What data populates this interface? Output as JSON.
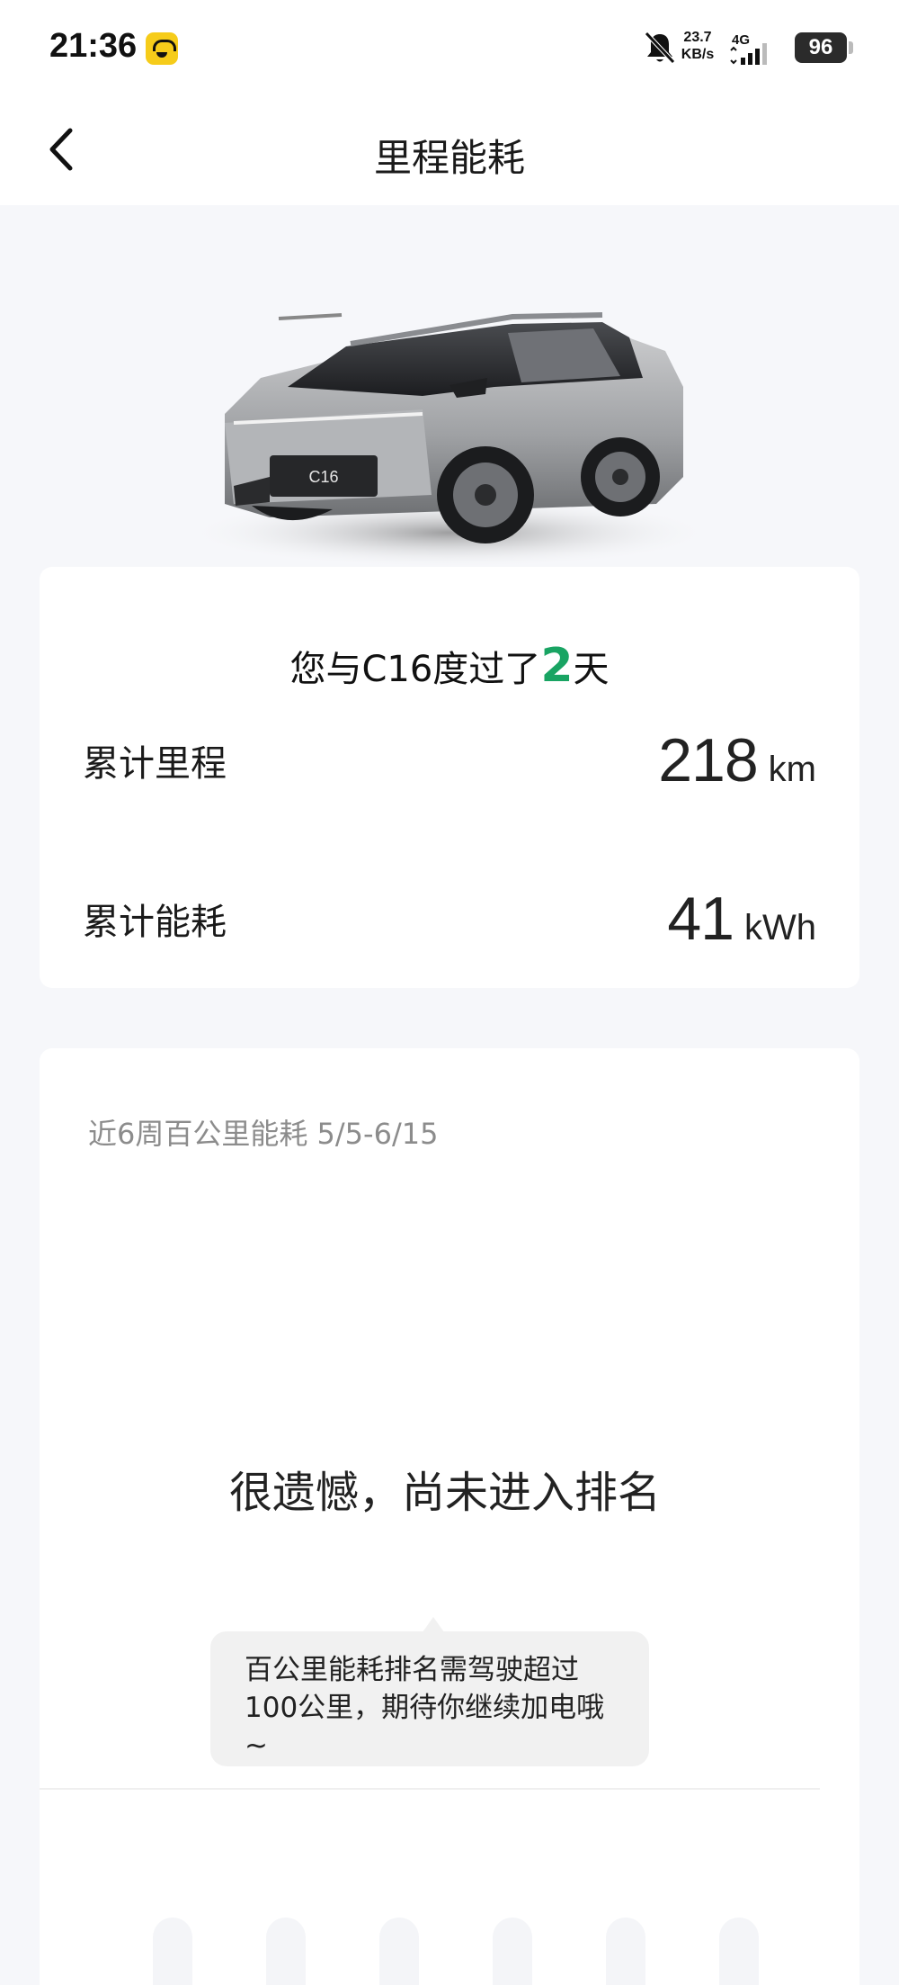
{
  "status_bar": {
    "time": "21:36",
    "net_speed_value": "23.7",
    "net_speed_unit": "KB/s",
    "network_type": "4G",
    "battery": "96",
    "icons": [
      "app-icon",
      "bell-muted-icon",
      "signal-icon",
      "battery-icon"
    ]
  },
  "header": {
    "title": "里程能耗",
    "back_icon": "chevron-left-icon"
  },
  "summary": {
    "days_prefix": "您与C16度过了",
    "days_value": "2",
    "days_suffix": "天",
    "mileage_label": "累计里程",
    "mileage_value": "218",
    "mileage_unit": "km",
    "energy_label": "累计能耗",
    "energy_value": "41",
    "energy_unit": "kWh",
    "car_badge": "C16"
  },
  "ranking": {
    "subtitle": "近6周百公里能耗 5/5-6/15",
    "not_ranked": "很遗憾，尚未进入排名",
    "tip": "百公里能耗排名需驾驶超过100公里，期待你继续加电哦~"
  },
  "colors": {
    "accent_green": "#19a463",
    "page_bg": "#f6f7fa",
    "muted_text": "#8c8c8c"
  }
}
